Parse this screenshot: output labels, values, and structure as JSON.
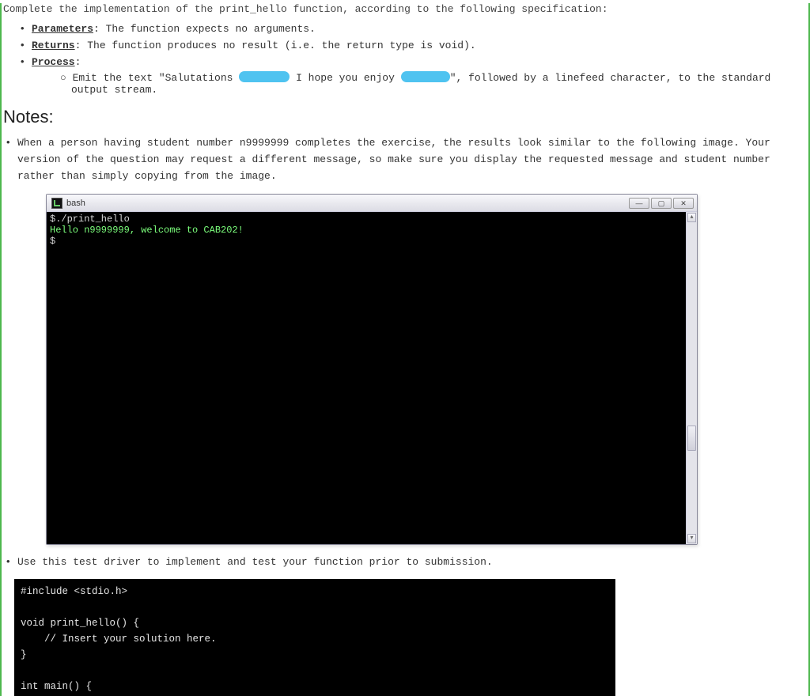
{
  "spec": {
    "intro": "Complete the implementation of the print_hello function, according to the following specification:",
    "params_label": "Parameters",
    "params_text": ": The function expects no arguments.",
    "returns_label": "Returns",
    "returns_text": ": The function produces no result (i.e. the return type is void).",
    "process_label": "Process",
    "process_text": ":",
    "emit_pre": "Emit the text \"Salutations ",
    "emit_mid": " I hope you enjoy ",
    "emit_post": "\", followed by a linefeed character, to the standard output stream."
  },
  "notes": {
    "heading": "Notes:",
    "item1": "When a person having student number n9999999 completes the exercise, the results look similar to the following image. Your version of the question may request a different message, so make sure you display the requested message and student number rather than simply copying from the image.",
    "item2": "Use this test driver to implement and test your function prior to submission."
  },
  "terminal": {
    "title": "bash",
    "btn_min": "—",
    "btn_max": "▢",
    "btn_close": "✕",
    "scroll_up": "▴",
    "scroll_down": "▾",
    "lines": {
      "l1": "$./print_hello",
      "l2": "Hello n9999999, welcome to CAB202!",
      "l3": "$"
    }
  },
  "code": {
    "l1": "#include <stdio.h>",
    "l2": "",
    "l3": "void print_hello() {",
    "l4": "    // Insert your solution here.",
    "l5": "}",
    "l6": "",
    "l7": "int main() {"
  }
}
